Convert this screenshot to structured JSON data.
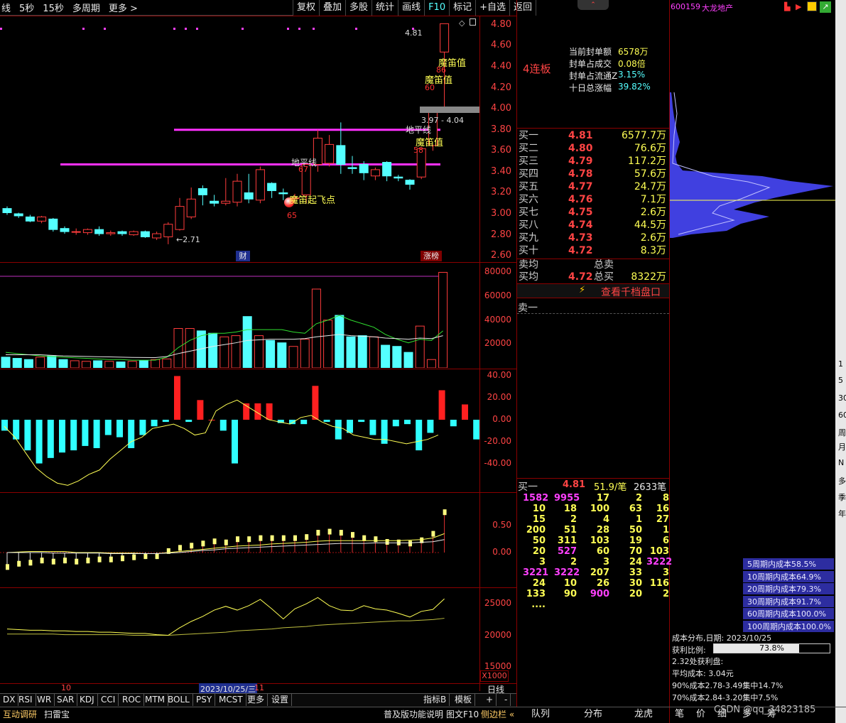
{
  "toolbar_left": [
    "线",
    "5秒",
    "15秒",
    "多周期",
    "更多 >"
  ],
  "toolbar_right": [
    "复权",
    "叠加",
    "多股",
    "统计",
    "画线",
    "F10",
    "标记",
    "+自选",
    "返回"
  ],
  "stock": {
    "code": "600159",
    "name": "大龙地产"
  },
  "main_chart": {
    "y_ticks": [
      "4.80",
      "4.60",
      "4.40",
      "4.20",
      "4.00",
      "3.80",
      "3.60",
      "3.40",
      "3.20",
      "3.00",
      "2.80",
      "2.60"
    ],
    "high_label": "4.81",
    "low_label": "←2.71",
    "range_label": "3.97 - 4.04",
    "annotations": [
      {
        "text": "魔笛值",
        "num": "86"
      },
      {
        "text": "魔笛值",
        "num": "60"
      },
      {
        "text": "魔笛值",
        "num": "58"
      },
      {
        "text": "地平线",
        "num": ""
      },
      {
        "text": "地平线",
        "num": "67"
      },
      {
        "text": "魔笛起飞点",
        "num": "65"
      }
    ],
    "tags": [
      "财",
      "涨榜"
    ]
  },
  "candles": [
    {
      "o": 3.05,
      "c": 3.01,
      "h": 3.07,
      "l": 2.99
    },
    {
      "o": 3.0,
      "c": 2.98,
      "h": 3.01,
      "l": 2.96
    },
    {
      "o": 2.97,
      "c": 2.93,
      "h": 2.99,
      "l": 2.92
    },
    {
      "o": 2.93,
      "c": 2.97,
      "h": 2.98,
      "l": 2.91
    },
    {
      "o": 2.95,
      "c": 2.85,
      "h": 2.96,
      "l": 2.83
    },
    {
      "o": 2.86,
      "c": 2.83,
      "h": 2.88,
      "l": 2.81
    },
    {
      "o": 2.83,
      "c": 2.83,
      "h": 2.86,
      "l": 2.8
    },
    {
      "o": 2.82,
      "c": 2.85,
      "h": 2.86,
      "l": 2.8
    },
    {
      "o": 2.85,
      "c": 2.81,
      "h": 2.88,
      "l": 2.79
    },
    {
      "o": 2.81,
      "c": 2.82,
      "h": 2.84,
      "l": 2.79
    },
    {
      "o": 2.83,
      "c": 2.81,
      "h": 2.84,
      "l": 2.79
    },
    {
      "o": 2.8,
      "c": 2.83,
      "h": 2.84,
      "l": 2.79
    },
    {
      "o": 2.83,
      "c": 2.78,
      "h": 2.84,
      "l": 2.77
    },
    {
      "o": 2.77,
      "c": 2.81,
      "h": 2.83,
      "l": 2.75
    },
    {
      "o": 2.78,
      "c": 2.9,
      "h": 2.92,
      "l": 2.71
    },
    {
      "o": 2.85,
      "c": 3.07,
      "h": 3.15,
      "l": 2.84
    },
    {
      "o": 2.97,
      "c": 3.14,
      "h": 3.25,
      "l": 2.95
    },
    {
      "o": 3.24,
      "c": 3.18,
      "h": 3.27,
      "l": 3.08
    },
    {
      "o": 3.12,
      "c": 3.1,
      "h": 3.18,
      "l": 3.07
    },
    {
      "o": 3.1,
      "c": 3.12,
      "h": 3.34,
      "l": 3.08
    },
    {
      "o": 3.11,
      "c": 3.31,
      "h": 3.38,
      "l": 3.07
    },
    {
      "o": 3.2,
      "c": 3.14,
      "h": 3.38,
      "l": 3.1
    },
    {
      "o": 3.13,
      "c": 3.42,
      "h": 3.45,
      "l": 3.1
    },
    {
      "o": 3.29,
      "c": 3.22,
      "h": 3.3,
      "l": 3.15
    },
    {
      "o": 3.2,
      "c": 3.19,
      "h": 3.24,
      "l": 3.13
    },
    {
      "o": 3.15,
      "c": 3.15,
      "h": 3.19,
      "l": 3.1
    },
    {
      "o": 3.18,
      "c": 3.47,
      "h": 3.48,
      "l": 3.1
    },
    {
      "o": 3.47,
      "c": 3.72,
      "h": 3.8,
      "l": 3.4
    },
    {
      "o": 3.48,
      "c": 3.66,
      "h": 3.75,
      "l": 3.45
    },
    {
      "o": 3.65,
      "c": 3.47,
      "h": 3.87,
      "l": 3.38
    },
    {
      "o": 3.44,
      "c": 3.43,
      "h": 3.55,
      "l": 3.38
    },
    {
      "o": 3.47,
      "c": 3.39,
      "h": 3.5,
      "l": 3.32
    },
    {
      "o": 3.36,
      "c": 3.42,
      "h": 3.44,
      "l": 3.32
    },
    {
      "o": 3.49,
      "c": 3.36,
      "h": 3.5,
      "l": 3.31
    },
    {
      "o": 3.35,
      "c": 3.34,
      "h": 3.37,
      "l": 3.31
    },
    {
      "o": 3.32,
      "c": 3.28,
      "h": 3.33,
      "l": 3.23
    },
    {
      "o": 3.35,
      "c": 3.62,
      "h": 3.62,
      "l": 3.33
    },
    {
      "o": 3.65,
      "c": 3.97,
      "h": 3.99,
      "l": 3.6
    },
    {
      "o": 4.54,
      "c": 4.81,
      "h": 4.81,
      "l": 3.97
    }
  ],
  "volume": {
    "y_ticks": [
      "80000",
      "60000",
      "40000",
      "20000"
    ],
    "bars": [
      9000,
      8000,
      7000,
      9000,
      10000,
      7000,
      6000,
      5500,
      6000,
      5500,
      5000,
      5500,
      6000,
      7000,
      7500,
      33000,
      33000,
      31000,
      29000,
      26000,
      27000,
      43000,
      27000,
      23000,
      21000,
      18000,
      24000,
      66000,
      40000,
      44000,
      26000,
      27000,
      26000,
      19000,
      18000,
      13000,
      35000,
      7000,
      80000
    ],
    "ma1": [
      13000,
      12000,
      11000,
      10000,
      9500,
      9000,
      8500,
      8000,
      7500,
      7000,
      7000,
      6500,
      6500,
      6500,
      9000,
      17000,
      23000,
      27000,
      29000,
      29000,
      30000,
      32000,
      32000,
      32000,
      32000,
      30000,
      29000,
      37000,
      40000,
      44000,
      40000,
      37000,
      34000,
      28000,
      24000,
      21000,
      24000,
      23000,
      31000
    ],
    "ma2": [
      11000,
      11000,
      11000,
      11000,
      10500,
      10000,
      9800,
      9600,
      9400,
      9200,
      9000,
      8800,
      8700,
      8600,
      9500,
      12000,
      14000,
      16000,
      18000,
      19500,
      21000,
      23000,
      23500,
      24000,
      24000,
      24000,
      24500,
      26000,
      27000,
      28000,
      27000,
      26500,
      26000,
      25000,
      24500,
      24000,
      25000,
      24500,
      27000
    ]
  },
  "macd": {
    "y_ticks": [
      "40.00",
      "20.00",
      "0.00",
      "-20.00",
      "-40.00"
    ],
    "bars": [
      -10,
      -18,
      -28,
      -40,
      -35,
      -30,
      -28,
      -24,
      -26,
      -14,
      -16,
      -26,
      -14,
      -6,
      -2,
      40,
      -2,
      18,
      0,
      -10,
      -40,
      15,
      15,
      15,
      -3,
      -4,
      -4,
      31,
      -2,
      -18,
      -12,
      -2,
      -14,
      -22,
      -6,
      -4,
      -28,
      -12,
      27,
      -6,
      14,
      -18
    ],
    "line": [
      -6,
      -16,
      -30,
      -44,
      -52,
      -58,
      -60,
      -56,
      -50,
      -46,
      -36,
      -28,
      -20,
      -16,
      -8,
      -6,
      -4,
      -8,
      -14,
      -12,
      8,
      14,
      18,
      12,
      6,
      0,
      -2,
      -4,
      2,
      4,
      -2,
      -6,
      -8,
      -14,
      -16,
      -18,
      -18,
      -20,
      -22,
      -20,
      -18,
      -14
    ]
  },
  "osc": {
    "y_ticks": [
      "0.50",
      "0.00"
    ]
  },
  "price_line": {
    "y_ticks": [
      "25000",
      "20000",
      "15000"
    ],
    "x_label": "X1000"
  },
  "x_axis": {
    "labels": [
      "10",
      "2023/10/25/三",
      "11",
      "日线"
    ]
  },
  "bottom_tabs": [
    "DX",
    "RSI",
    "WR",
    "SAR",
    "KDJ",
    "CCI",
    "ROC",
    "MTM",
    "BOLL",
    "PSY",
    "MCST",
    "更多",
    "设置",
    "指标B",
    "模板",
    "+",
    "-"
  ],
  "bottom_bar": [
    "互动调研",
    "扫雷宝",
    "普及版功能说明",
    "图文F10",
    "侧边栏 «"
  ],
  "right_panel": {
    "limit_up": "4连板",
    "stats": [
      {
        "label": "当前封单额",
        "value": "6578万"
      },
      {
        "label": "封单占成交",
        "value": "0.08倍"
      },
      {
        "label": "封单占流通Z",
        "value": "3.15%"
      },
      {
        "label": "十日总涨幅",
        "value": "39.82%"
      }
    ],
    "bids": [
      {
        "label": "买一",
        "price": "4.81",
        "vol": "6577.7万"
      },
      {
        "label": "买二",
        "price": "4.80",
        "vol": "76.6万"
      },
      {
        "label": "买三",
        "price": "4.79",
        "vol": "117.2万"
      },
      {
        "label": "买四",
        "price": "4.78",
        "vol": "57.6万"
      },
      {
        "label": "买五",
        "price": "4.77",
        "vol": "24.7万"
      },
      {
        "label": "买六",
        "price": "4.76",
        "vol": "7.1万"
      },
      {
        "label": "买七",
        "price": "4.75",
        "vol": "2.6万"
      },
      {
        "label": "买八",
        "price": "4.74",
        "vol": "44.5万"
      },
      {
        "label": "买九",
        "price": "4.73",
        "vol": "2.6万"
      },
      {
        "label": "买十",
        "price": "4.72",
        "vol": "8.3万"
      }
    ],
    "sell_avg": "卖均",
    "buy_avg": "买均",
    "buy_avg_price": "4.72",
    "total_sell": "总卖",
    "total_buy": "总买",
    "total_buy_val": "8322万",
    "depth_link": "查看千档盘口",
    "ask1": "卖一",
    "queue_header": {
      "label": "买一",
      "price": "4.81",
      "per": "51.9/笔",
      "count": "2633笔"
    },
    "queue": [
      [
        "1582",
        "9955",
        "17",
        "2",
        "8"
      ],
      [
        "10",
        "18",
        "100",
        "63",
        "16"
      ],
      [
        "15",
        "2",
        "4",
        "1",
        "27"
      ],
      [
        "200",
        "51",
        "28",
        "50",
        "1"
      ],
      [
        "50",
        "311",
        "103",
        "19",
        "6"
      ],
      [
        "20",
        "527",
        "60",
        "70",
        "103"
      ],
      [
        "3",
        "2",
        "3",
        "24",
        "3222"
      ],
      [
        "3221",
        "3222",
        "207",
        "33",
        "3"
      ],
      [
        "24",
        "10",
        "26",
        "30",
        "116"
      ],
      [
        "133",
        "90",
        "900",
        "20",
        "2"
      ],
      [
        "....",
        "",
        "",
        "",
        ""
      ]
    ],
    "queue_colors": [
      [
        "m",
        "m",
        "y",
        "y",
        "y"
      ],
      [
        "y",
        "y",
        "y",
        "y",
        "y"
      ],
      [
        "y",
        "y",
        "y",
        "y",
        "y"
      ],
      [
        "y",
        "y",
        "y",
        "y",
        "y"
      ],
      [
        "y",
        "y",
        "y",
        "y",
        "y"
      ],
      [
        "y",
        "m",
        "y",
        "y",
        "y"
      ],
      [
        "y",
        "y",
        "y",
        "y",
        "m"
      ],
      [
        "m",
        "m",
        "y",
        "y",
        "y"
      ],
      [
        "y",
        "y",
        "y",
        "y",
        "y"
      ],
      [
        "y",
        "y",
        "m",
        "y",
        "y"
      ],
      [
        "y",
        "",
        "",
        "",
        ""
      ]
    ],
    "tabs": [
      "队列",
      "分布",
      "龙虎"
    ]
  },
  "cost_panel": {
    "periods": [
      "5周期内成本58.5%",
      "10周期内成本64.9%",
      "20周期内成本79.3%",
      "30周期内成本91.7%",
      "60周期内成本100.0%",
      "100周期内成本100.0%"
    ],
    "date_label": "成本分布,日期: 2023/10/25",
    "profit_label": "获利比例:",
    "profit_pct": "73.8%",
    "profit_value": 0.738,
    "profit_disk": "2.32处获利盘:",
    "avg_cost": "平均成本: 3.04元",
    "c90": "90%成本2.78-3.49集中14.7%",
    "c70": "70%成本2.84-3.20集中7.5%",
    "tabs": [
      "笔",
      "价",
      "细",
      "多",
      "筹"
    ]
  },
  "far_right": [
    "1",
    "5",
    "30",
    "60",
    "周",
    "月",
    "N",
    "多",
    "季",
    "年"
  ],
  "watermark": "CSDN @qq_34823185"
}
